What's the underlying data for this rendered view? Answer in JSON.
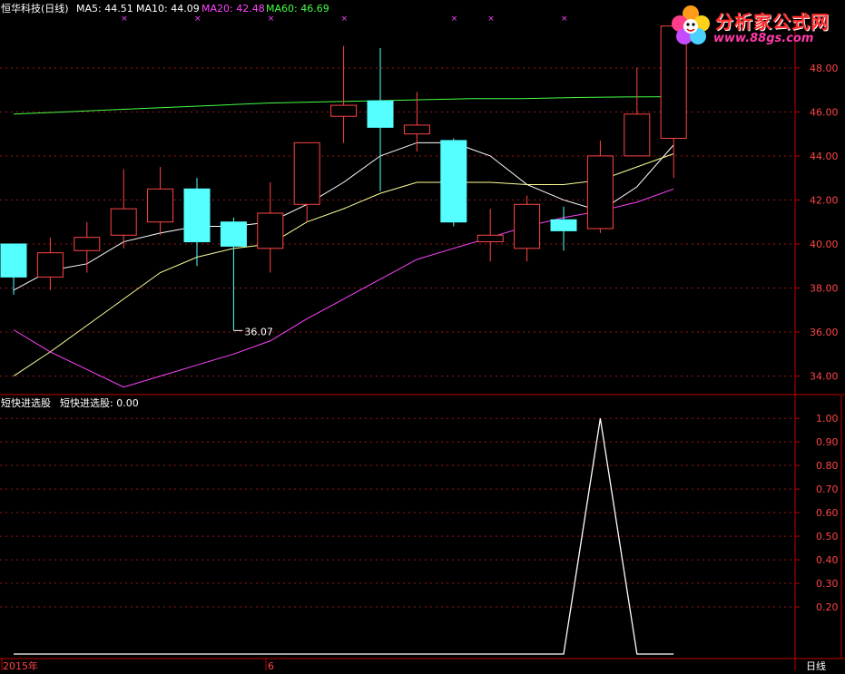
{
  "stock": {
    "name": "恒华科技(日线)"
  },
  "ma_legend": [
    {
      "label": "MA5: 44.51",
      "color": "#ffffff"
    },
    {
      "label": "MA10: 44.09",
      "color": "#ffffff"
    },
    {
      "label": "MA20: 42.48",
      "color": "#ff44ff"
    },
    {
      "label": "MA60: 46.69",
      "color": "#44ff44"
    }
  ],
  "watermark": {
    "title": "分析家公式网",
    "url": "www.88gs.com"
  },
  "indicator": {
    "name": "短快进选股",
    "value_label": "短快进选股: 0.00"
  },
  "low_annotation": "36.07",
  "x_axis": {
    "start_label": "2015年",
    "month_label": "6"
  },
  "period_label": "日线",
  "colors": {
    "up": "#ff4444",
    "down": "#55ffff",
    "ma5": "#ffffff",
    "ma10": "#ffff99",
    "ma20": "#ff44ff",
    "ma60": "#44ff44",
    "grid": "#a0141a",
    "border": "#c00000",
    "signal_marker": "#ff44ff"
  },
  "chart_data": [
    {
      "type": "candlestick",
      "title": "恒华科技(日线)",
      "y_ticks": [
        34,
        36,
        38,
        40,
        42,
        44,
        46,
        48
      ],
      "y_tick_labels": [
        "34.00",
        "36.00",
        "38.00",
        "40.00",
        "42.00",
        "44.00",
        "46.00",
        "48.00"
      ],
      "ylim": [
        33.2,
        50.3
      ],
      "candles": [
        {
          "o": 40.0,
          "c": 38.5,
          "h": 40.0,
          "l": 37.7
        },
        {
          "o": 38.5,
          "c": 39.6,
          "h": 40.3,
          "l": 37.9
        },
        {
          "o": 39.7,
          "c": 40.3,
          "h": 41.0,
          "l": 38.7
        },
        {
          "o": 40.4,
          "c": 41.6,
          "h": 43.4,
          "l": 39.8
        },
        {
          "o": 41.0,
          "c": 42.5,
          "h": 43.5,
          "l": 40.4
        },
        {
          "o": 42.5,
          "c": 40.1,
          "h": 43.0,
          "l": 39.0
        },
        {
          "o": 41.0,
          "c": 39.9,
          "h": 41.2,
          "l": 36.07
        },
        {
          "o": 39.8,
          "c": 41.4,
          "h": 42.8,
          "l": 38.7
        },
        {
          "o": 41.8,
          "c": 44.6,
          "h": 44.6,
          "l": 41.0
        },
        {
          "o": 45.8,
          "c": 46.3,
          "h": 49.0,
          "l": 44.6
        },
        {
          "o": 46.5,
          "c": 45.3,
          "h": 48.9,
          "l": 42.4
        },
        {
          "o": 45.0,
          "c": 45.4,
          "h": 46.9,
          "l": 44.2
        },
        {
          "o": 44.7,
          "c": 41.0,
          "h": 44.8,
          "l": 40.8
        },
        {
          "o": 40.1,
          "c": 40.4,
          "h": 41.6,
          "l": 39.2
        },
        {
          "o": 39.8,
          "c": 41.8,
          "h": 42.2,
          "l": 39.2
        },
        {
          "o": 41.1,
          "c": 40.6,
          "h": 41.7,
          "l": 39.7
        },
        {
          "o": 40.7,
          "c": 44.0,
          "h": 44.7,
          "l": 40.5
        },
        {
          "o": 44.0,
          "c": 45.9,
          "h": 48.0,
          "l": 44.0
        },
        {
          "o": 44.8,
          "c": 49.9,
          "h": 49.9,
          "l": 43.0
        }
      ],
      "series": [
        {
          "name": "MA5",
          "values": [
            37.9,
            38.8,
            39.1,
            40.1,
            40.5,
            40.8,
            40.8,
            41.0,
            41.8,
            42.8,
            44.0,
            44.6,
            44.6,
            44.0,
            42.7,
            42.0,
            41.5,
            42.6,
            44.5
          ]
        },
        {
          "name": "MA10",
          "values": [
            34.0,
            35.1,
            36.3,
            37.5,
            38.7,
            39.4,
            39.8,
            40.0,
            41.0,
            41.6,
            42.3,
            42.8,
            42.8,
            42.8,
            42.7,
            42.7,
            42.9,
            43.5,
            44.1
          ]
        },
        {
          "name": "MA20",
          "values": [
            36.1,
            35.1,
            34.3,
            33.5,
            34.0,
            34.5,
            35.0,
            35.6,
            36.6,
            37.5,
            38.4,
            39.3,
            39.8,
            40.3,
            40.8,
            41.2,
            41.5,
            41.9,
            42.5
          ]
        },
        {
          "name": "MA60",
          "values": [
            45.9,
            46.0,
            46.1,
            46.2,
            46.3,
            46.4,
            46.45,
            46.5,
            46.55,
            46.6,
            46.6,
            46.65,
            46.68,
            46.69
          ]
        }
      ],
      "signal_markers_at": [
        3,
        5,
        7,
        9,
        12,
        13,
        15
      ]
    },
    {
      "type": "line",
      "title": "短快进选股",
      "y_ticks": [
        0.2,
        0.3,
        0.4,
        0.5,
        0.6,
        0.7,
        0.8,
        0.9,
        1.0
      ],
      "y_tick_labels": [
        "0.20",
        "0.30",
        "0.40",
        "0.50",
        "0.60",
        "0.70",
        "0.80",
        "0.90",
        "1.00"
      ],
      "ylim": [
        0,
        1.02
      ],
      "series": [
        {
          "name": "短快进选股",
          "values": [
            0,
            0,
            0,
            0,
            0,
            0,
            0,
            0,
            0,
            0,
            0,
            0,
            0,
            0,
            0,
            0,
            1,
            0,
            0
          ]
        }
      ]
    }
  ]
}
